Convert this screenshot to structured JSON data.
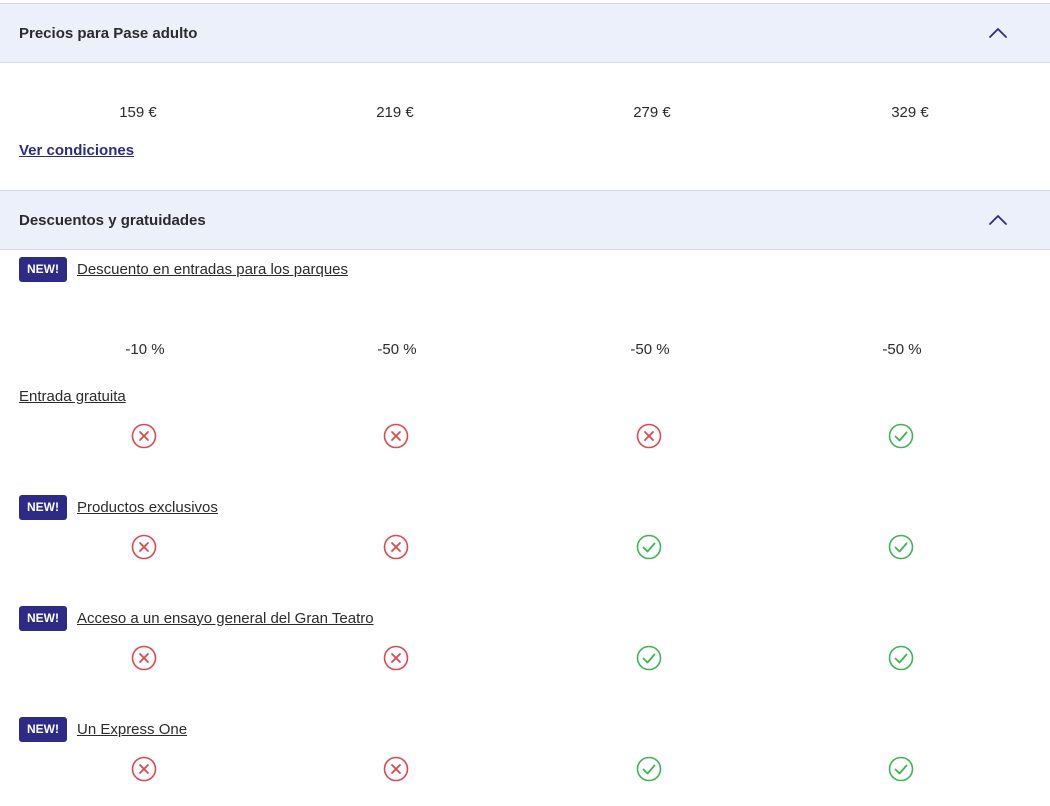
{
  "prices_section": {
    "title": "Precios para Pase adulto",
    "prices": [
      "159 €",
      "219 €",
      "279 €",
      "329 €"
    ],
    "conditions_link": "Ver condiciones"
  },
  "discounts_section": {
    "title": "Descuentos y gratuidades"
  },
  "badge_label": "NEW!",
  "benefits": [
    {
      "label": "Descuento en entradas para los parques",
      "is_new": true,
      "values": [
        "-10 %",
        "-50 %",
        "-50 %",
        "-50 %"
      ]
    },
    {
      "label": "Entrada gratuita",
      "is_new": false,
      "included": [
        false,
        false,
        false,
        true
      ]
    },
    {
      "label": "Productos exclusivos",
      "is_new": true,
      "included": [
        false,
        false,
        true,
        true
      ]
    },
    {
      "label": "Acceso a un ensayo general del Gran Teatro",
      "is_new": true,
      "included": [
        false,
        false,
        true,
        true
      ]
    },
    {
      "label": "Un Express One",
      "is_new": true,
      "included": [
        false,
        false,
        true,
        true
      ]
    }
  ],
  "icons": {
    "yes": "check-circle-icon",
    "no": "x-circle-icon",
    "collapse": "chevron-up-icon"
  },
  "colors": {
    "brand": "#2d2b86",
    "yes": "#3db552",
    "no": "#e0474c",
    "header_bg": "#ecf0fb"
  }
}
